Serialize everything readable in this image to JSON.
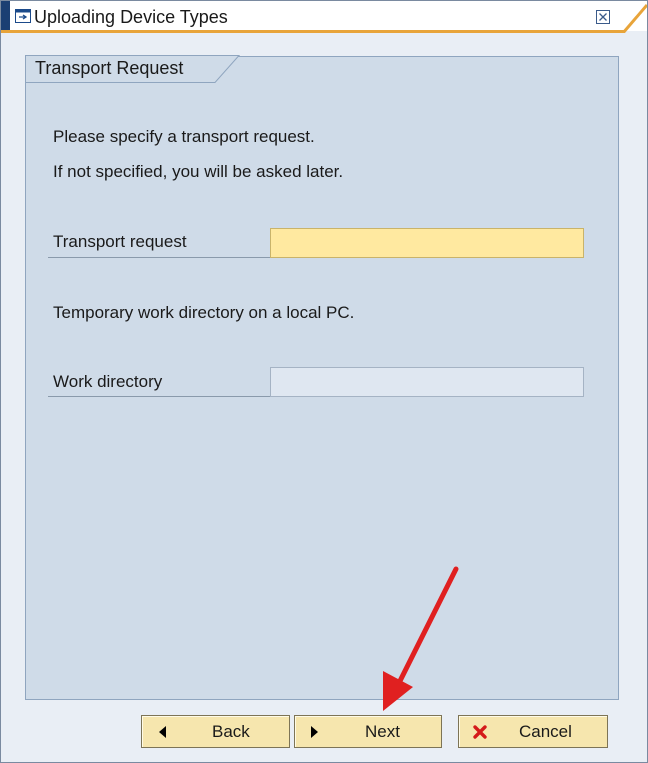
{
  "window": {
    "title": "Uploading Device Types"
  },
  "tab": {
    "label": "Transport Request"
  },
  "content": {
    "intro_line1": "Please specify a transport request.",
    "intro_line2": "If not specified, you will be asked later.",
    "transport_label": "Transport request",
    "transport_value": "",
    "workdir_note": "Temporary work directory on a local PC.",
    "workdir_label": "Work directory",
    "workdir_value": ""
  },
  "buttons": {
    "back": "Back",
    "next": "Next",
    "cancel": "Cancel"
  },
  "colors": {
    "required_field": "#ffe9a0",
    "panel": "#cfdbe8",
    "button": "#f6e6ae",
    "annotation_arrow": "#e02020"
  },
  "icons": {
    "title": "dialog-icon",
    "close": "close-icon",
    "back": "triangle-left-icon",
    "next": "triangle-right-icon",
    "cancel": "red-x-icon"
  }
}
